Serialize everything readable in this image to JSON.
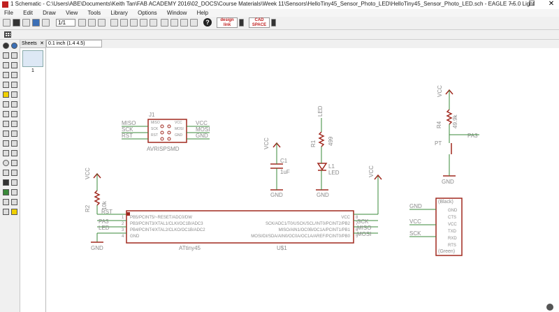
{
  "window": {
    "title": "1 Schematic - C:\\Users\\ABE\\Documents\\Keith Tan\\FAB ACADEMY 2016\\02_DOCS\\Course Materials\\Week 11\\Sensors\\HelloTiny45_Sensor_Photo_LED\\HelloTiny45_Sensor_Photo_LED.sch - EAGLE 7.5.0 Light",
    "min": "–",
    "max": "☐",
    "close": "✕"
  },
  "menu": [
    "File",
    "Edit",
    "Draw",
    "View",
    "Tools",
    "Library",
    "Options",
    "Window",
    "Help"
  ],
  "toolbar": {
    "zoom_value": "1/1",
    "help_label": "?",
    "badge1": "design link",
    "badge2": "CAD SPACE"
  },
  "sheets": {
    "title": "Sheets",
    "sheet_number": "1"
  },
  "coordinate": "0.1 inch (1.4 4.5)",
  "schematic": {
    "j1": {
      "name": "J1",
      "value": "AVRISPSMD",
      "left_pins": [
        "MISO",
        "SCK",
        "RST"
      ],
      "right_pins": [
        "VCC",
        "MOSI",
        "GND"
      ],
      "inner_left": [
        "MISO",
        "SCK",
        "RST"
      ],
      "inner_right": [
        "VCC",
        "MOSI",
        "GND"
      ]
    },
    "c1": {
      "vcc": "VCC",
      "name": "C1",
      "value": "1uF",
      "gnd": "GND"
    },
    "led": {
      "top": "LED",
      "r1": "R1",
      "r1v": "499",
      "l1": "L1",
      "l1v": "LED",
      "gnd": "GND"
    },
    "phototransistor": {
      "vcc": "VCC",
      "r4": "R4",
      "r4v": "49.9k",
      "label": "PA3",
      "pt": "PT",
      "gnd": "GND"
    },
    "pullup": {
      "vcc": "VCC",
      "r2": "R2",
      "r2v": "10k"
    },
    "mcu": {
      "left_nets": [
        "RST",
        "PA3",
        "LED",
        "GND"
      ],
      "left_pins": [
        "PB5/PCINT5/~RESET/ADC0/DW",
        "PB3/PCINT3/XTAL1/CLKI/OC1B/ADC3",
        "PB4/PCINT4/XTAL2/CLKO/OC1B/ADC2",
        "GND"
      ],
      "right_pins": [
        "VCC",
        "SCK/ADC1/T0/USCK/SCL/INT0/PCINT2/PB2",
        "MISO/AIN1/OC0B/OC1A/PCINT1/PB1",
        "MOSI/DI/SDA/AIN0/OC0A/OC1A/AREF/PCINT0/PB0"
      ],
      "right_nets": [
        "VCC",
        "SCK",
        "MISO",
        "MOSI"
      ],
      "left_nums": [
        "1",
        "2",
        "3",
        "4"
      ],
      "right_nums": [
        "8",
        "7",
        "6",
        "5"
      ],
      "part": "ATtiny45",
      "name": "U$1",
      "vcc_top": "VCC"
    },
    "ftdi": {
      "nets": [
        "GND",
        "VCC",
        "SCK"
      ],
      "top": "(Black)",
      "pins": [
        "GND",
        "CTS",
        "VCC",
        "TXD",
        "RXD",
        "RTS"
      ],
      "bottom": "(Green)"
    }
  },
  "colors": {
    "wire": "#3a8a3a",
    "symbol": "#a0281e",
    "text": "#8a8a8a"
  }
}
